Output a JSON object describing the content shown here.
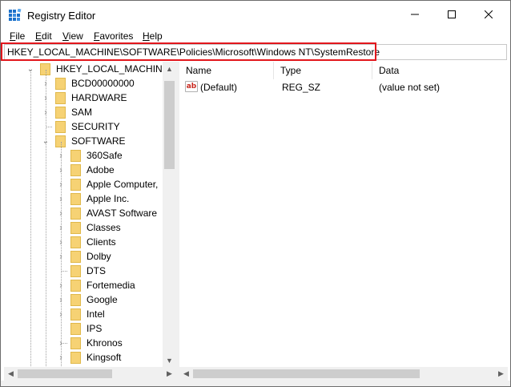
{
  "window": {
    "title": "Registry Editor",
    "minimize_glyph": "—",
    "maximize_glyph": "☐",
    "close_glyph": "✕"
  },
  "menu": [
    {
      "first": "F",
      "rest": "ile"
    },
    {
      "first": "E",
      "rest": "dit"
    },
    {
      "first": "V",
      "rest": "iew"
    },
    {
      "first": "F",
      "rest": "avorites"
    },
    {
      "first": "H",
      "rest": "elp"
    }
  ],
  "address": {
    "path": "HKEY_LOCAL_MACHINE\\SOFTWARE\\Policies\\Microsoft\\Windows NT\\SystemRestore",
    "highlight_color": "#e2161c"
  },
  "tree": {
    "root": "HKEY_LOCAL_MACHINE",
    "hive_children": [
      "BCD00000000",
      "HARDWARE",
      "SAM",
      "SECURITY",
      "SOFTWARE"
    ],
    "software_children": [
      "360Safe",
      "Adobe",
      "Apple Computer,",
      "Apple Inc.",
      "AVAST Software",
      "Classes",
      "Clients",
      "Dolby",
      "DTS",
      "Fortemedia",
      "Google",
      "Intel",
      "IPS",
      "Khronos",
      "Kingsoft"
    ],
    "folder_color": "#f6d274"
  },
  "list": {
    "columns": [
      "Name",
      "Type",
      "Data"
    ],
    "rows": [
      {
        "icon": "string-value-icon",
        "icon_text": "ab",
        "name": "(Default)",
        "type": "REG_SZ",
        "data": "(value not set)"
      }
    ]
  },
  "scroll": {
    "up": "▲",
    "down": "▼",
    "left": "◀",
    "right": "▶"
  }
}
